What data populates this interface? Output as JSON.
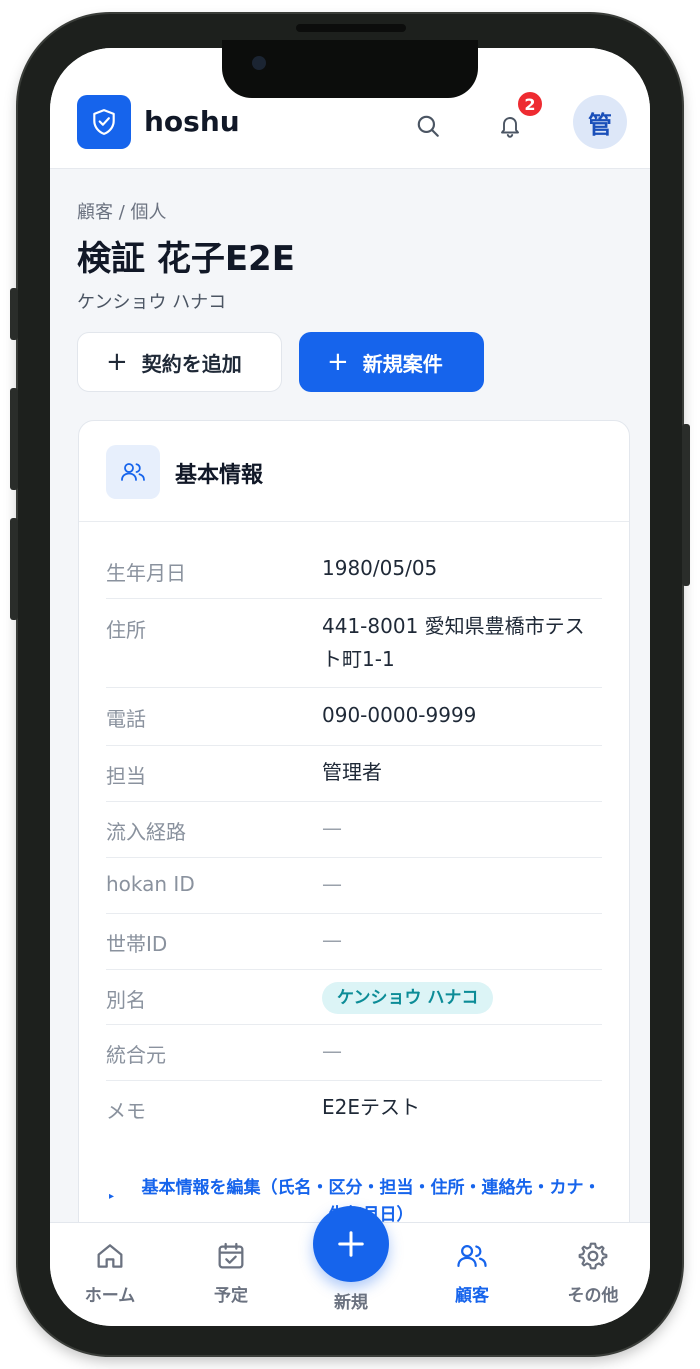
{
  "header": {
    "app_title": "hoshu",
    "notification_count": "2",
    "avatar_initial": "管"
  },
  "page": {
    "breadcrumb": "顧客 / 個人",
    "customer_name": "検証 花子E2E",
    "customer_kana": "ケンショウ ハナコ",
    "actions": [
      {
        "label": "契約を追加",
        "plus": "+"
      },
      {
        "label": "新規案件",
        "plus": "+"
      }
    ]
  },
  "card": {
    "title": "基本情報",
    "rows": [
      {
        "label": "生年月日",
        "value": "1980/05/05"
      },
      {
        "label": "住所",
        "value": "441-8001 愛知県豊橋市テスト町1-1"
      },
      {
        "label": "電話",
        "value": "090-0000-9999"
      },
      {
        "label": "担当",
        "value": "管理者"
      },
      {
        "label": "流入経路",
        "value": "—"
      },
      {
        "label": "hokan ID",
        "value": "—"
      },
      {
        "label": "世帯ID",
        "value": "—"
      },
      {
        "label": "別名",
        "value": "ケンショウ ハナコ"
      },
      {
        "label": "統合元",
        "value": "—"
      },
      {
        "label": "メモ",
        "value": "E2Eテスト"
      }
    ],
    "edit_link": "基本情報を編集（氏名・区分・担当・住所・連絡先・カナ・生年月日）",
    "edit_marker": "▸"
  },
  "nav": {
    "items": [
      {
        "label": "ホーム",
        "icon": "home-icon"
      },
      {
        "label": "予定",
        "icon": "calendar-check-icon"
      },
      {
        "label": "新規",
        "icon": "plus-icon"
      },
      {
        "label": "顧客",
        "icon": "users-icon"
      },
      {
        "label": "その他",
        "icon": "gear-icon"
      }
    ],
    "active": "顧客"
  },
  "colors": {
    "accent": "#1664ec",
    "badge": "#ee2b31",
    "pill_bg": "#dcf4f6",
    "pill_text": "#0c8c97"
  }
}
